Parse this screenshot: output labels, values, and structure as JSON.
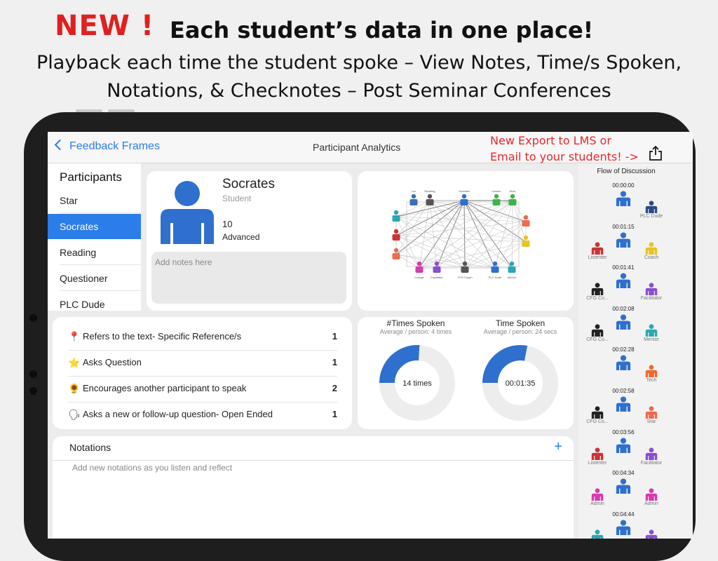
{
  "promo": {
    "badge": "NEW !",
    "headline": "Each student’s data in one place!",
    "sub_line1": "Playback each time the student spoke – View Notes, Time/s Spoken,",
    "sub_line2": "Notations, & Checknotes – Post Seminar Conferences"
  },
  "nav": {
    "back_label": "Feedback Frames",
    "title": "Participant Analytics",
    "export_line1": "New Export to LMS or",
    "export_line2": "Email to your students! ->"
  },
  "sidebar": {
    "heading": "Participants",
    "items": [
      {
        "label": "Star",
        "selected": false
      },
      {
        "label": "Socrates",
        "selected": true
      },
      {
        "label": "Reading",
        "selected": false
      },
      {
        "label": "Questioner",
        "selected": false
      },
      {
        "label": "PLC Dude",
        "selected": false
      }
    ]
  },
  "profile": {
    "name": "Socrates",
    "role": "Student",
    "score": "10",
    "level": "Advanced",
    "notes_placeholder": "Add notes here"
  },
  "network": {
    "top_labels": [
      "Lux",
      "Reading",
      "Socrates",
      "Lesson",
      "Stoic"
    ],
    "bottom_labels": [
      "Lounge",
      "Facilitator",
      "CFG Coach",
      "PLC Dude",
      "Mentor"
    ]
  },
  "checknotes": [
    {
      "icon": "pin-icon",
      "glyph": "📍",
      "label": "Refers to the text-  Specific Reference/s",
      "count": "1"
    },
    {
      "icon": "star-icon",
      "glyph": "⭐",
      "label": "Asks Question",
      "count": "1"
    },
    {
      "icon": "sunflower-icon",
      "glyph": "🌻",
      "label": "Encourages another participant to speak",
      "count": "2"
    },
    {
      "icon": "speaking-head-icon",
      "glyph": "🗣",
      "label": "Asks a new or follow-up question-  Open Ended",
      "count": "1"
    }
  ],
  "stats": {
    "times_spoken": {
      "title": "#Times Spoken",
      "subtitle": "Average / person: 4 times",
      "center_label": "14 times",
      "fraction": 0.26
    },
    "time_spoken": {
      "title": "Time Spoken",
      "subtitle": "Average / person: 24 secs",
      "center_label": "00:01:35",
      "fraction": 0.28
    }
  },
  "notations": {
    "heading": "Notations",
    "placeholder": "Add new notations as you listen and reflect"
  },
  "flow": {
    "title": "Flow of Discussion",
    "rows": [
      {
        "time": "00:00:00",
        "left": null,
        "right": {
          "label": "PLC Dude",
          "color": "#2a4a86"
        }
      },
      {
        "time": "00:01:15",
        "left": {
          "label": "Listenter",
          "color": "#cc3333"
        },
        "right": {
          "label": "Coach",
          "color": "#e8c51e"
        }
      },
      {
        "time": "00:01:41",
        "left": {
          "label": "CFG Co...",
          "color": "#222222"
        },
        "right": {
          "label": "Facilitator",
          "color": "#8a4fd0"
        }
      },
      {
        "time": "00:02:08",
        "left": {
          "label": "CFG Co...",
          "color": "#222222"
        },
        "right": {
          "label": "Mentor",
          "color": "#2aa7b0"
        }
      },
      {
        "time": "00:02:28",
        "left": null,
        "right": {
          "label": "Tech",
          "color": "#ee6a2c"
        }
      },
      {
        "time": "00:02:58",
        "left": {
          "label": "CFG Co...",
          "color": "#222222"
        },
        "right": {
          "label": "Star",
          "color": "#ee6a4a"
        }
      },
      {
        "time": "00:03:56",
        "left": {
          "label": "Listenter",
          "color": "#cc3333"
        },
        "right": {
          "label": "Facilitator",
          "color": "#8a4fd0"
        }
      },
      {
        "time": "00:04:34",
        "left": {
          "label": "Admin",
          "color": "#d83ab0"
        },
        "right": {
          "label": "Admin",
          "color": "#d83ab0"
        }
      },
      {
        "time": "00:04:44",
        "left": {
          "label": "",
          "color": "#2aa7b0"
        },
        "right": {
          "label": "",
          "color": "#8a4fd0"
        }
      }
    ]
  },
  "colors": {
    "accent": "#2b7de9",
    "promo_red": "#e02020",
    "export_red": "#e8262c",
    "ring_track": "#ededed"
  }
}
